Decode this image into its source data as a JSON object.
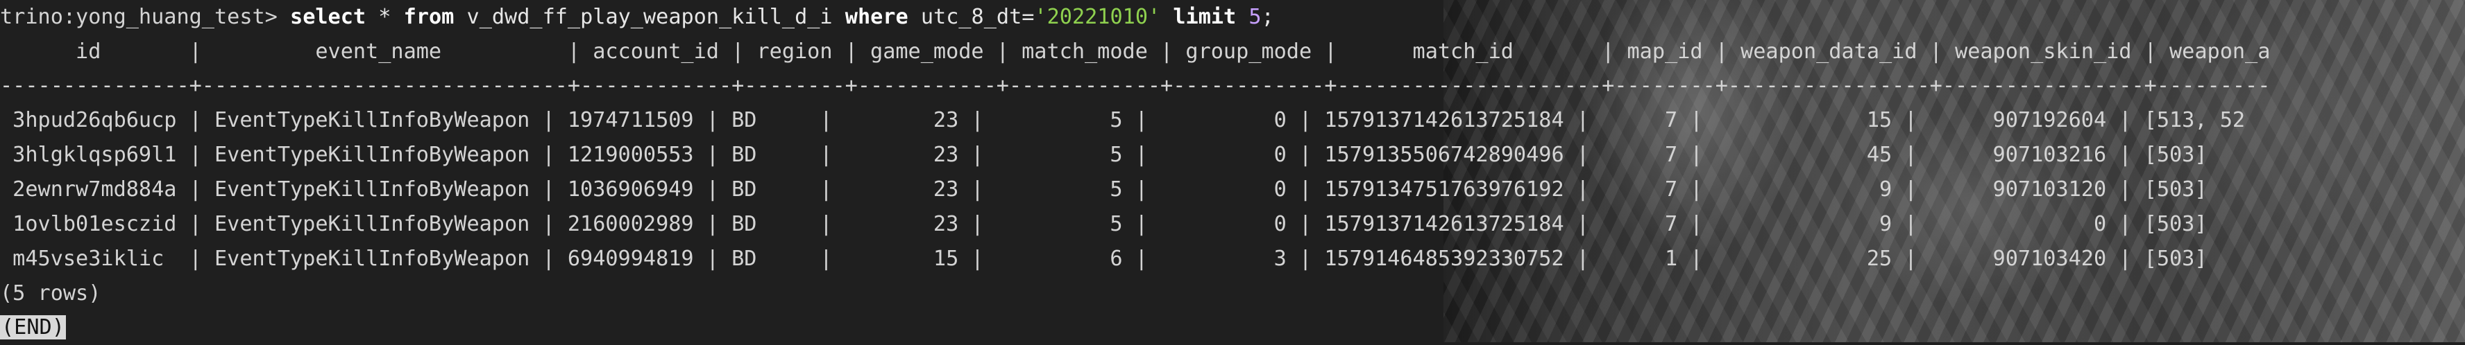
{
  "prompt": "trino:yong_huang_test>",
  "query": {
    "kw_select": "select",
    "star": "*",
    "kw_from": "from",
    "table": "v_dwd_ff_play_weapon_kill_d_i",
    "kw_where": "where",
    "condition": "utc_8_dt=",
    "date_literal": "'20221010'",
    "kw_limit": "limit",
    "limit_value": "5",
    "terminator": ";"
  },
  "header_line": "      id       |         event_name          | account_id | region | game_mode | match_mode | group_mode |      match_id       | map_id | weapon_data_id | weapon_skin_id | weapon_a",
  "separator_line": "---------------+-----------------------------+------------+--------+-----------+------------+------------+---------------------+--------+----------------+----------------+---------",
  "rows": [
    " 3hpud26qb6ucp | EventTypeKillInfoByWeapon | 1974711509 | BD     |        23 |          5 |          0 | 1579137142613725184 |      7 |             15 |      907192604 | [513, 52",
    " 3hlgklqsp69l1 | EventTypeKillInfoByWeapon | 1219000553 | BD     |        23 |          5 |          0 | 1579135506742890496 |      7 |             45 |      907103216 | [503]",
    " 2ewnrw7md884a | EventTypeKillInfoByWeapon | 1036906949 | BD     |        23 |          5 |          0 | 1579134751763976192 |      7 |              9 |      907103120 | [503]",
    " 1ovlb01esczid | EventTypeKillInfoByWeapon | 2160002989 | BD     |        23 |          5 |          0 | 1579137142613725184 |      7 |              9 |              0 | [503]",
    " m45vse3iklic  | EventTypeKillInfoByWeapon | 6940994819 | BD     |        15 |          6 |          3 | 1579146485392330752 |      1 |             25 |      907103420 | [503]"
  ],
  "row_count": "(5 rows)",
  "pager_end": "(END)"
}
